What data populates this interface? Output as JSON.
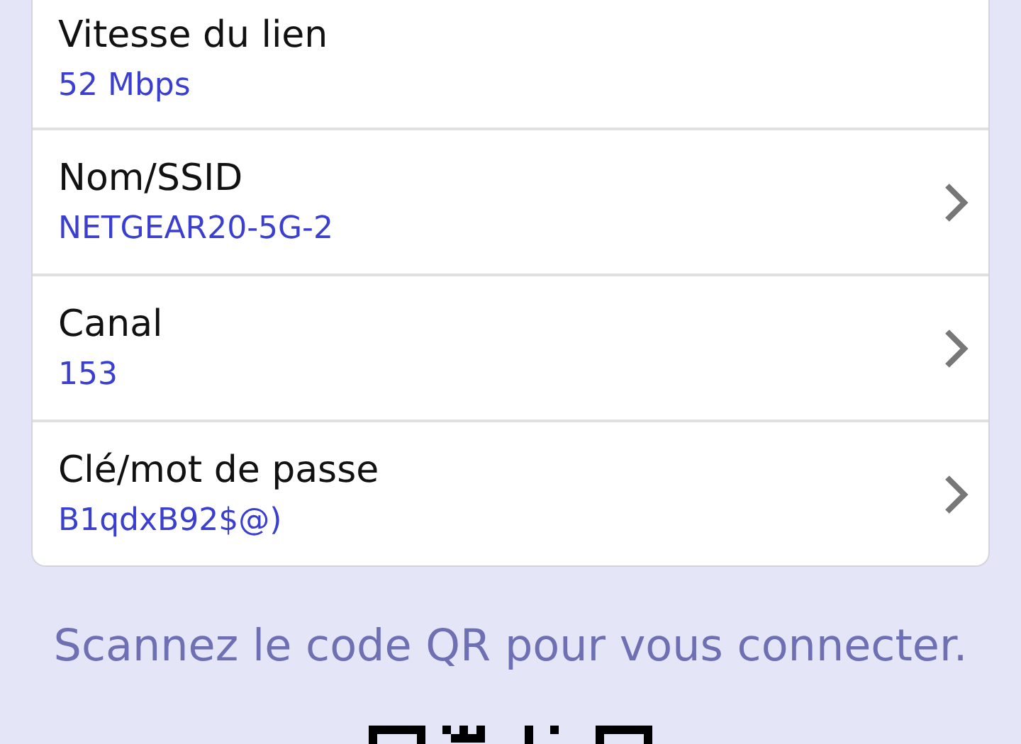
{
  "rows": [
    {
      "label": "Vitesse du lien",
      "value": "52 Mbps",
      "navigable": false
    },
    {
      "label": "Nom/SSID",
      "value": "NETGEAR20-5G-2",
      "navigable": true
    },
    {
      "label": "Canal",
      "value": "153",
      "navigable": true
    },
    {
      "label": "Clé/mot de passe",
      "value": "B1qdxB92$@)",
      "navigable": true
    }
  ],
  "qr_caption": "Scannez le code QR pour vous connecter."
}
